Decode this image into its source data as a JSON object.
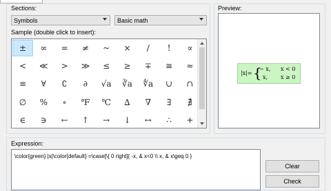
{
  "sections": {
    "label": "Sections:",
    "category": "Symbols",
    "subcategory": "Basic math"
  },
  "sample": {
    "label": "Sample (double click to insert):",
    "symbols": [
      "±",
      "∞",
      "=",
      "≠",
      "~",
      "×",
      "/",
      "!",
      "∝",
      "<",
      "≪",
      ">",
      "≫",
      "≤",
      "≥",
      "∓",
      "≅",
      "≈",
      "≡",
      "∀",
      "∁",
      "∂",
      "√a",
      "∛a",
      "∜a",
      "∪",
      "∩",
      "∅",
      "%",
      "∘",
      "℉",
      "℃",
      "∆",
      "∇",
      "∃",
      "∄",
      "∈",
      "∋",
      "←",
      "↑",
      "→",
      "↓",
      "↔",
      "∴",
      "+"
    ]
  },
  "preview": {
    "label": "Preview:",
    "lhs": "|x|=",
    "row1_left": "− x,",
    "row1_right": "x < 0",
    "row2_left": "x,",
    "row2_right": "x ≥ 0"
  },
  "expression": {
    "label": "Expression:",
    "value": "\\color{green} |x|\\color{default} =\\case[\\{ 0 right]{ -x, & x<0 \\\\ x, & x\\geq 0 }"
  },
  "buttons": {
    "clear": "Clear",
    "check": "Check"
  },
  "colors": {
    "highlight": "#cce8ff",
    "preview_bg": "#ccf5c4"
  }
}
